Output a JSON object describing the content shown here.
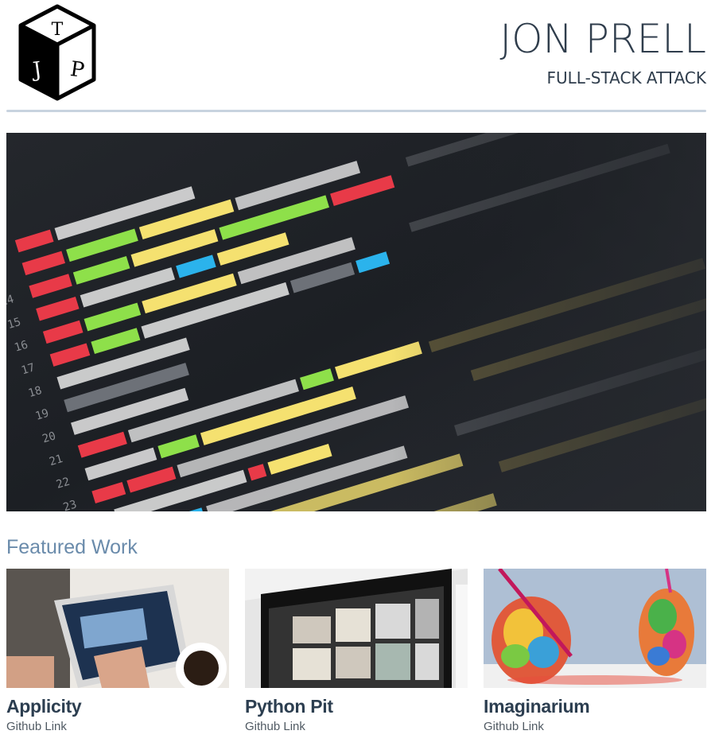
{
  "header": {
    "title": "JON PRELL",
    "subtitle": "FULL-STACK ATTACK",
    "logo_icon": "jtp-dice-logo-icon"
  },
  "hero": {
    "image": "code-editor-photo"
  },
  "featured": {
    "heading": "Featured Work",
    "items": [
      {
        "title": "Applicity",
        "link_label": "Github Link",
        "image": "tablet-photo"
      },
      {
        "title": "Python Pit",
        "link_label": "Github Link",
        "image": "monitor-photo"
      },
      {
        "title": "Imaginarium",
        "link_label": "Github Link",
        "image": "painted-hands-photo"
      }
    ]
  },
  "colors": {
    "title_text": "#2f3d4c",
    "section_heading": "#6a8bab",
    "divider": "#c8d3df"
  }
}
